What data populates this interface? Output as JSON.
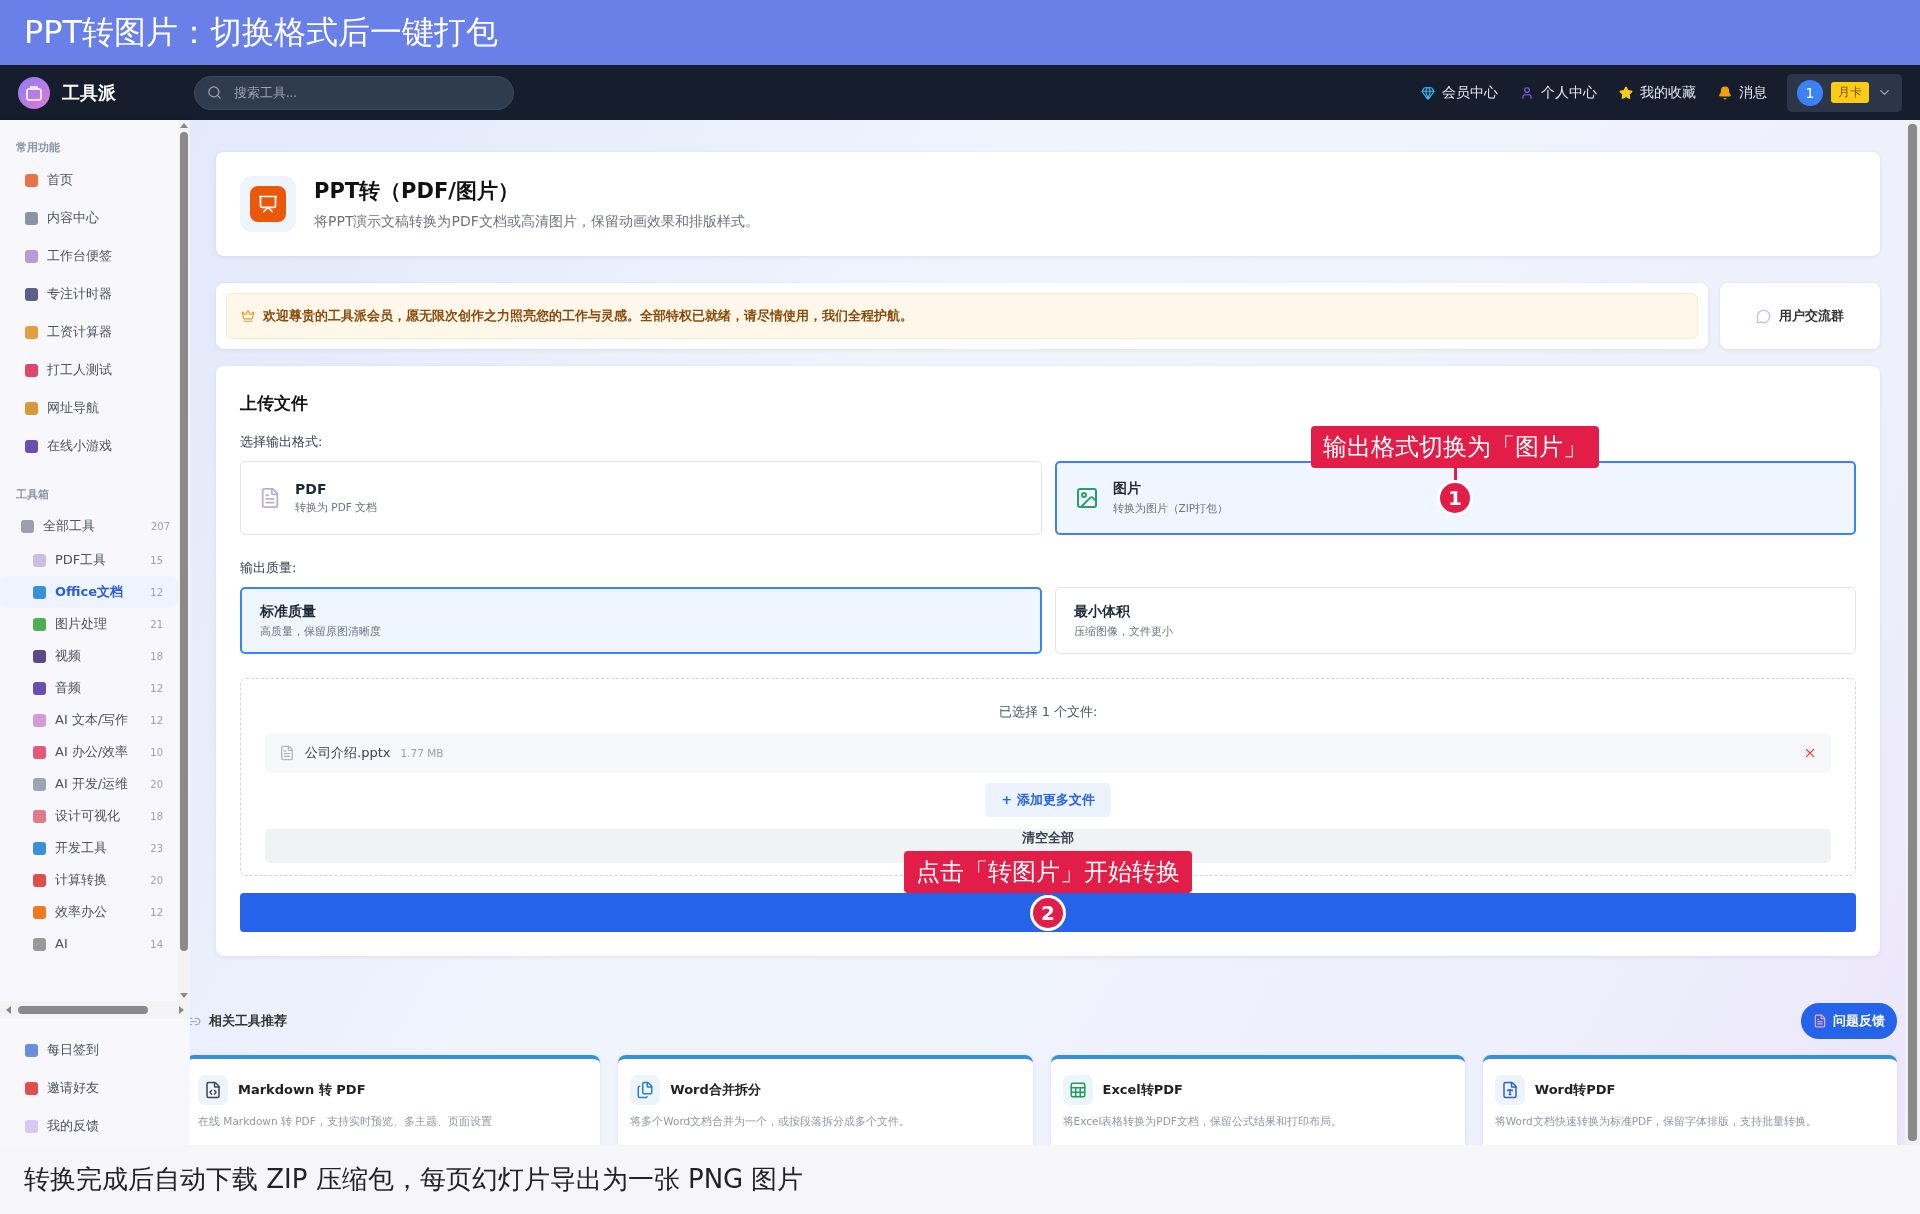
{
  "banner": {
    "title": "PPT转图片：切换格式后一键打包"
  },
  "navbar": {
    "logo": "工具派",
    "search": {
      "placeholder": "搜索工具..."
    },
    "links": [
      "会员中心",
      "个人中心",
      "我的收藏",
      "消息"
    ],
    "user": {
      "avatar": "1",
      "badge": "月卡"
    }
  },
  "sidebar": {
    "sections": [
      {
        "title": "常用功能",
        "items": [
          {
            "label": "首页",
            "selected": false
          },
          {
            "label": "内容中心",
            "selected": false
          },
          {
            "label": "工作台便签",
            "selected": false
          },
          {
            "label": "专注计时器",
            "selected": false
          },
          {
            "label": "工资计算器",
            "selected": false
          },
          {
            "label": "打工人测试",
            "selected": false
          },
          {
            "label": "网址导航",
            "selected": false
          },
          {
            "label": "在线小游戏",
            "selected": false
          }
        ]
      },
      {
        "title": "工具箱",
        "items": [
          {
            "label": "全部工具",
            "count": "207",
            "selected": false,
            "children": [
              {
                "label": "PDF工具",
                "count": "15",
                "selected": false
              },
              {
                "label": "Office文档",
                "count": "12",
                "selected": true
              },
              {
                "label": "图片处理",
                "count": "21",
                "selected": false
              },
              {
                "label": "视频",
                "count": "18",
                "selected": false
              },
              {
                "label": "音频",
                "count": "12",
                "selected": false
              },
              {
                "label": "AI 文本/写作",
                "count": "12",
                "selected": false
              },
              {
                "label": "AI 办公/效率",
                "count": "10",
                "selected": false
              },
              {
                "label": "AI 开发/运维",
                "count": "20",
                "selected": false
              },
              {
                "label": "设计可视化",
                "count": "18",
                "selected": false
              },
              {
                "label": "开发工具",
                "count": "23",
                "selected": false
              },
              {
                "label": "计算转换",
                "count": "20",
                "selected": false
              },
              {
                "label": "效率办公",
                "count": "12",
                "selected": false
              },
              {
                "label": "AI",
                "count": "14",
                "selected": false
              }
            ]
          }
        ]
      }
    ],
    "footer_items": [
      "每日签到",
      "邀请好友",
      "我的反馈"
    ]
  },
  "tool": {
    "title": "PPT转（PDF/图片）",
    "description": "将PPT演示文稿转换为PDF文档或高清图片，保留动画效果和排版样式。"
  },
  "notice": {
    "text": "欢迎尊贵的工具派会员，愿无限次创作之力照亮您的工作与灵感。全部特权已就绪，请尽情使用，我们全程护航。",
    "group_button": "用户交流群"
  },
  "upload": {
    "title": "上传文件",
    "format_label": "选择输出格式:",
    "formats": [
      {
        "kind": "pdf",
        "name": "PDF",
        "description": "转换为 PDF 文档",
        "selected": false
      },
      {
        "kind": "image",
        "name": "图片",
        "description": "转换为图片（ZIP打包）",
        "selected": true
      }
    ],
    "quality_label": "输出质量:",
    "qualities": [
      {
        "name": "标准质量",
        "description": "高质量，保留原图清晰度",
        "selected": true
      },
      {
        "name": "最小体积",
        "description": "压缩图像，文件更小",
        "selected": false
      }
    ],
    "files_label": "已选择 1 个文件:",
    "files": [
      {
        "name": "公司介绍.pptx",
        "size": "1.77 MB"
      }
    ],
    "add_button": "+ 添加更多文件",
    "clear_button": "清空全部"
  },
  "annotations": [
    {
      "number": "1",
      "text": "输出格式切换为「图片」"
    },
    {
      "number": "2",
      "text": "点击「转图片」开始转换"
    }
  ],
  "related": {
    "title": "相关工具推荐",
    "feedback_button": "问题反馈",
    "tools": [
      {
        "kind": "markdown",
        "name": "Markdown 转 PDF",
        "description": "在线 Markdown 转 PDF，支持实时预览、多主题、页面设置"
      },
      {
        "kind": "word-split",
        "name": "Word合并拆分",
        "description": "将多个Word文档合并为一个，或按段落拆分成多个文件。"
      },
      {
        "kind": "excel",
        "name": "Excel转PDF",
        "description": "将Excel表格转换为PDF文档，保留公式结果和打印布局。"
      },
      {
        "kind": "word",
        "name": "Word转PDF",
        "description": "将Word文档快速转换为标准PDF，保留字体排版，支持批量转换。"
      }
    ]
  },
  "caption": {
    "text": "转换完成后自动下载 ZIP 压缩包，每页幻灯片导出为一张 PNG 图片"
  }
}
